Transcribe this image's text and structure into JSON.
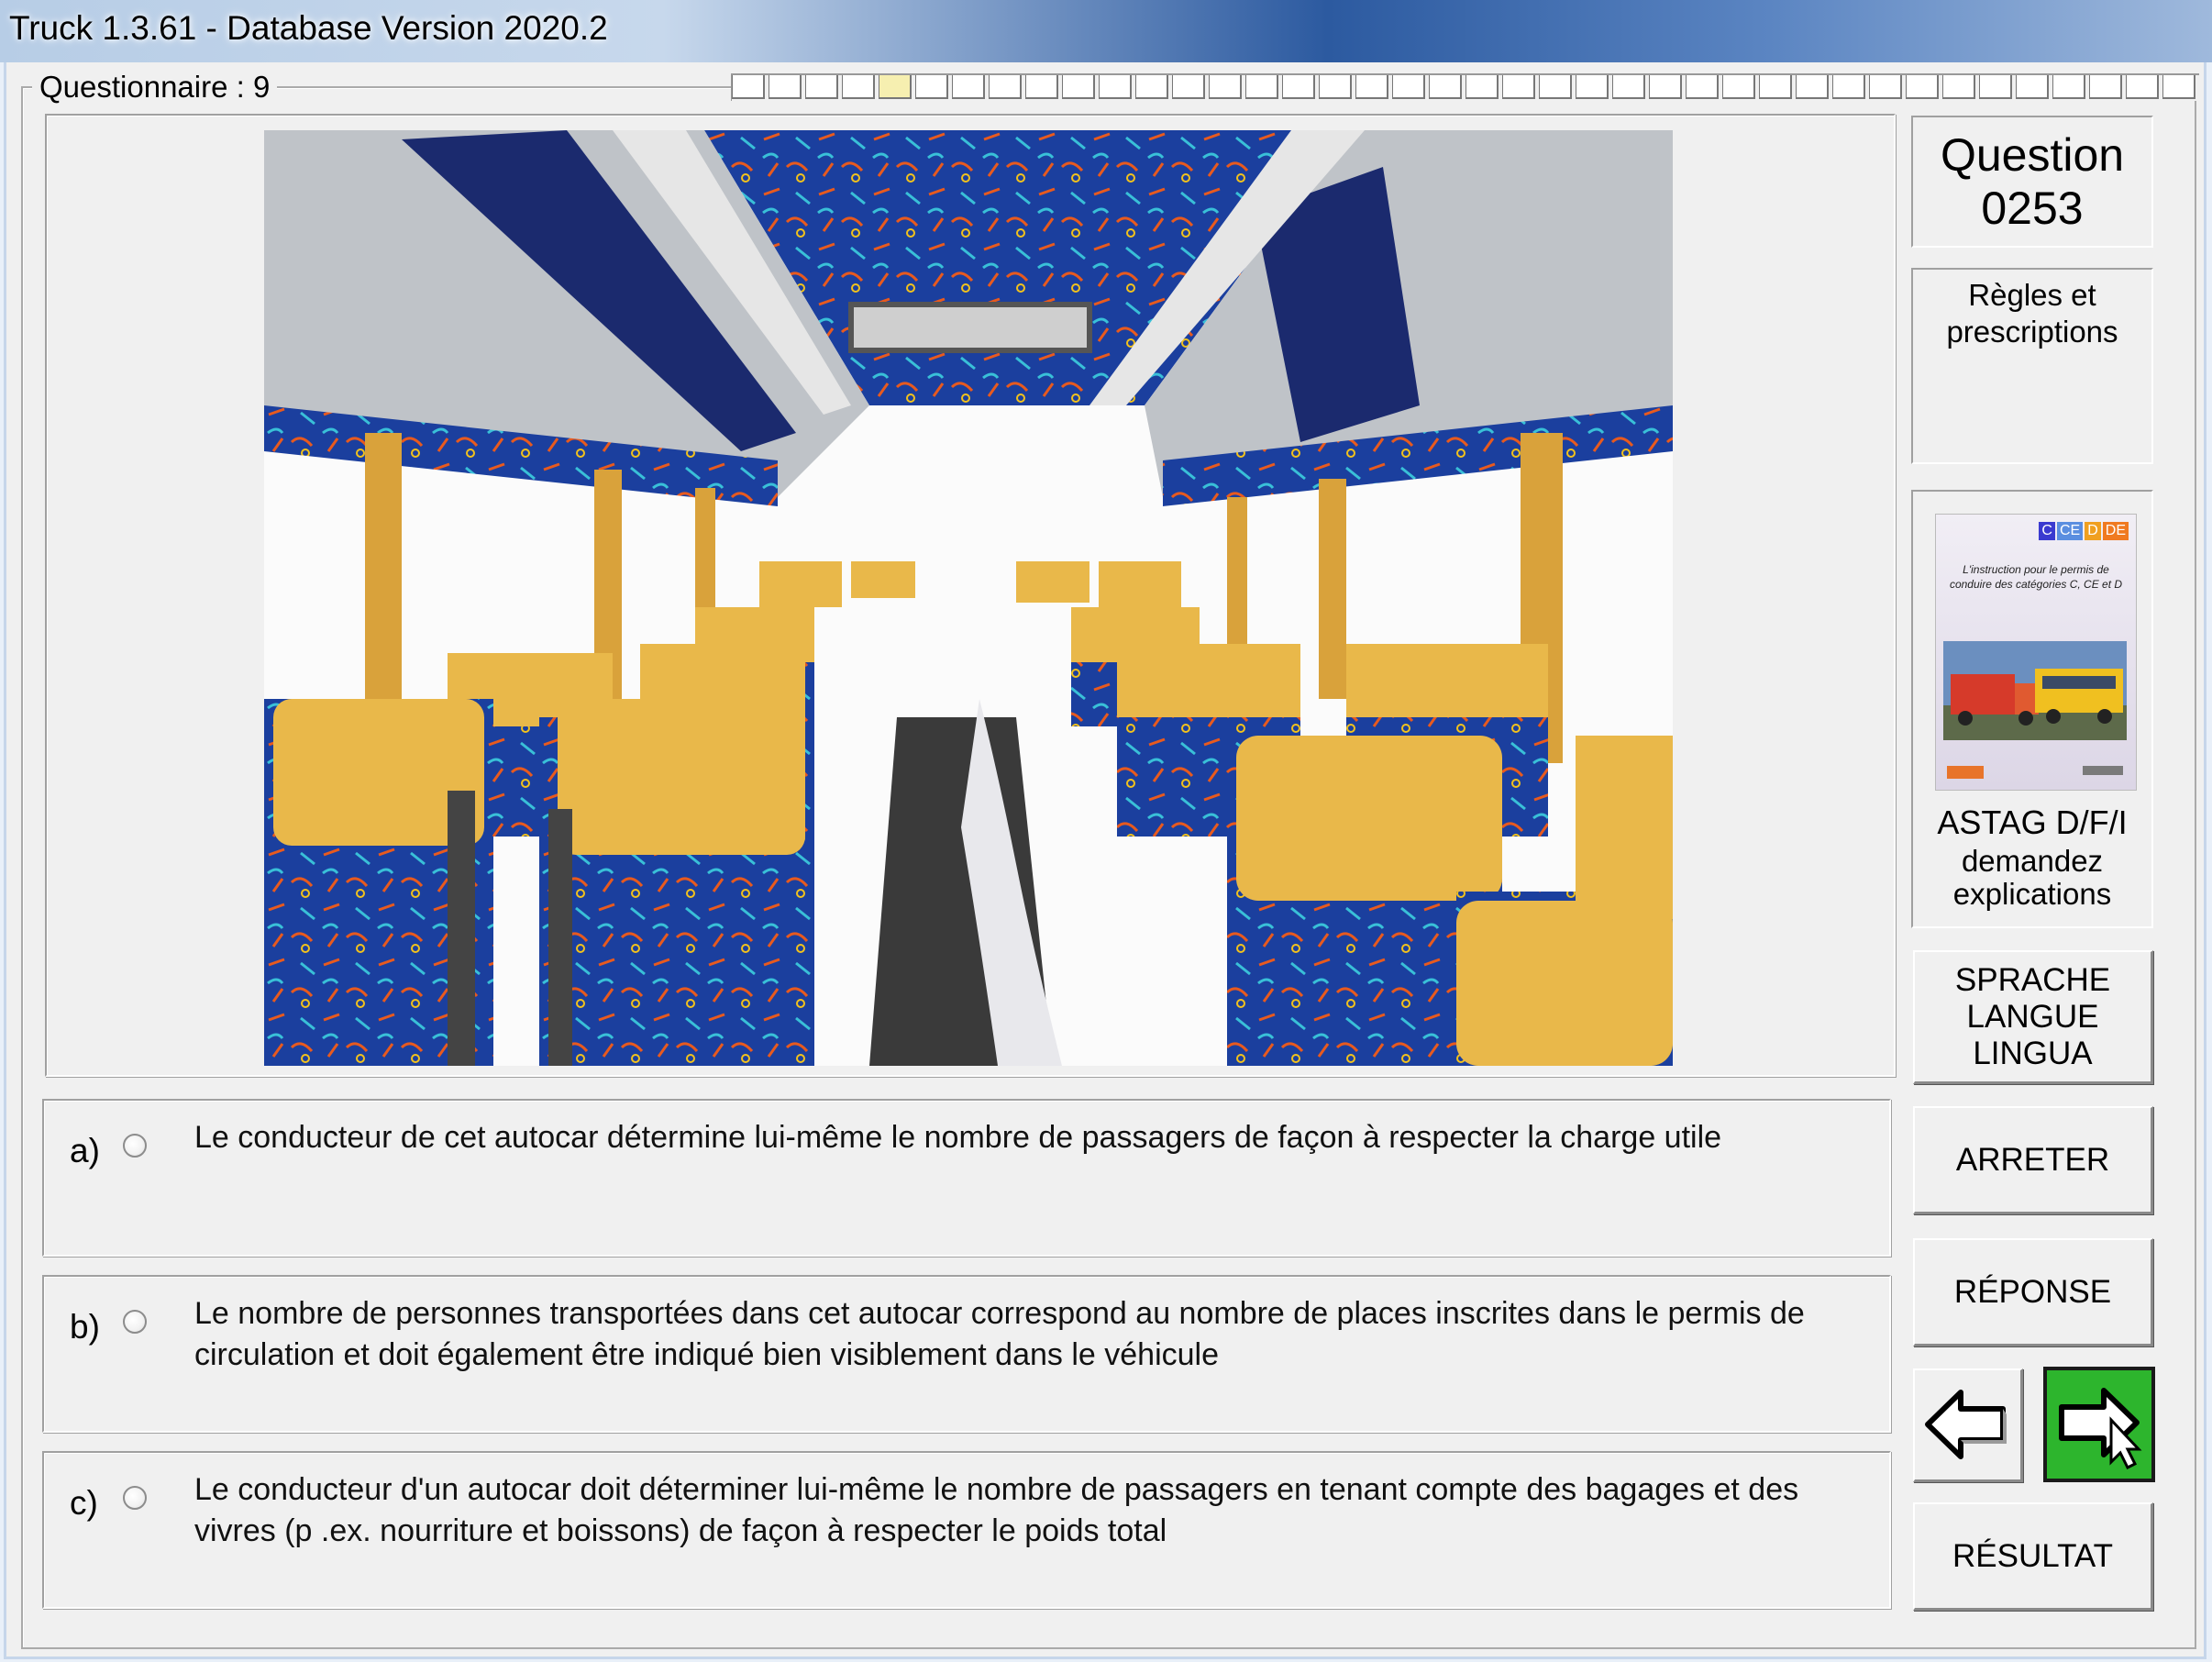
{
  "window": {
    "title": "Truck 1.3.61 - Database Version 2020.2"
  },
  "questionnaire": {
    "label": "Questionnaire : 9"
  },
  "question": {
    "word": "Question",
    "number": "0253"
  },
  "rules": {
    "line1": "Règles et",
    "line2": "prescriptions"
  },
  "astag": {
    "book_badges": [
      "C",
      "CE",
      "D",
      "DE"
    ],
    "book_title": "L'instruction pour le permis de conduire des catégories C, CE et D",
    "line1": "ASTAG D/F/I",
    "line2": "demandez",
    "line3": "explications"
  },
  "buttons": {
    "language_1": "SPRACHE",
    "language_2": "LANGUE",
    "language_3": "LINGUA",
    "stop": "ARRETER",
    "answer": "RÉPONSE",
    "result": "RÉSULTAT"
  },
  "answers": [
    {
      "letter": "a)",
      "text": "Le conducteur de cet autocar détermine lui-même le nombre de passagers de façon à respecter la charge utile"
    },
    {
      "letter": "b)",
      "text": "Le nombre de personnes transportées dans cet autocar correspond au nombre de places inscrites dans le permis de circulation et doit également être indiqué bien visiblement dans le véhicule"
    },
    {
      "letter": "c)",
      "text": "Le conducteur d'un autocar doit déterminer lui-même le nombre de passagers en tenant compte des bagages et des vivres (p .ex. nourriture et boissons) de façon à respecter le poids total"
    }
  ],
  "colors": {
    "next_button": "#2db52d",
    "seat_fabric": "#1b3f9e",
    "headrest": "#e9b84a"
  }
}
